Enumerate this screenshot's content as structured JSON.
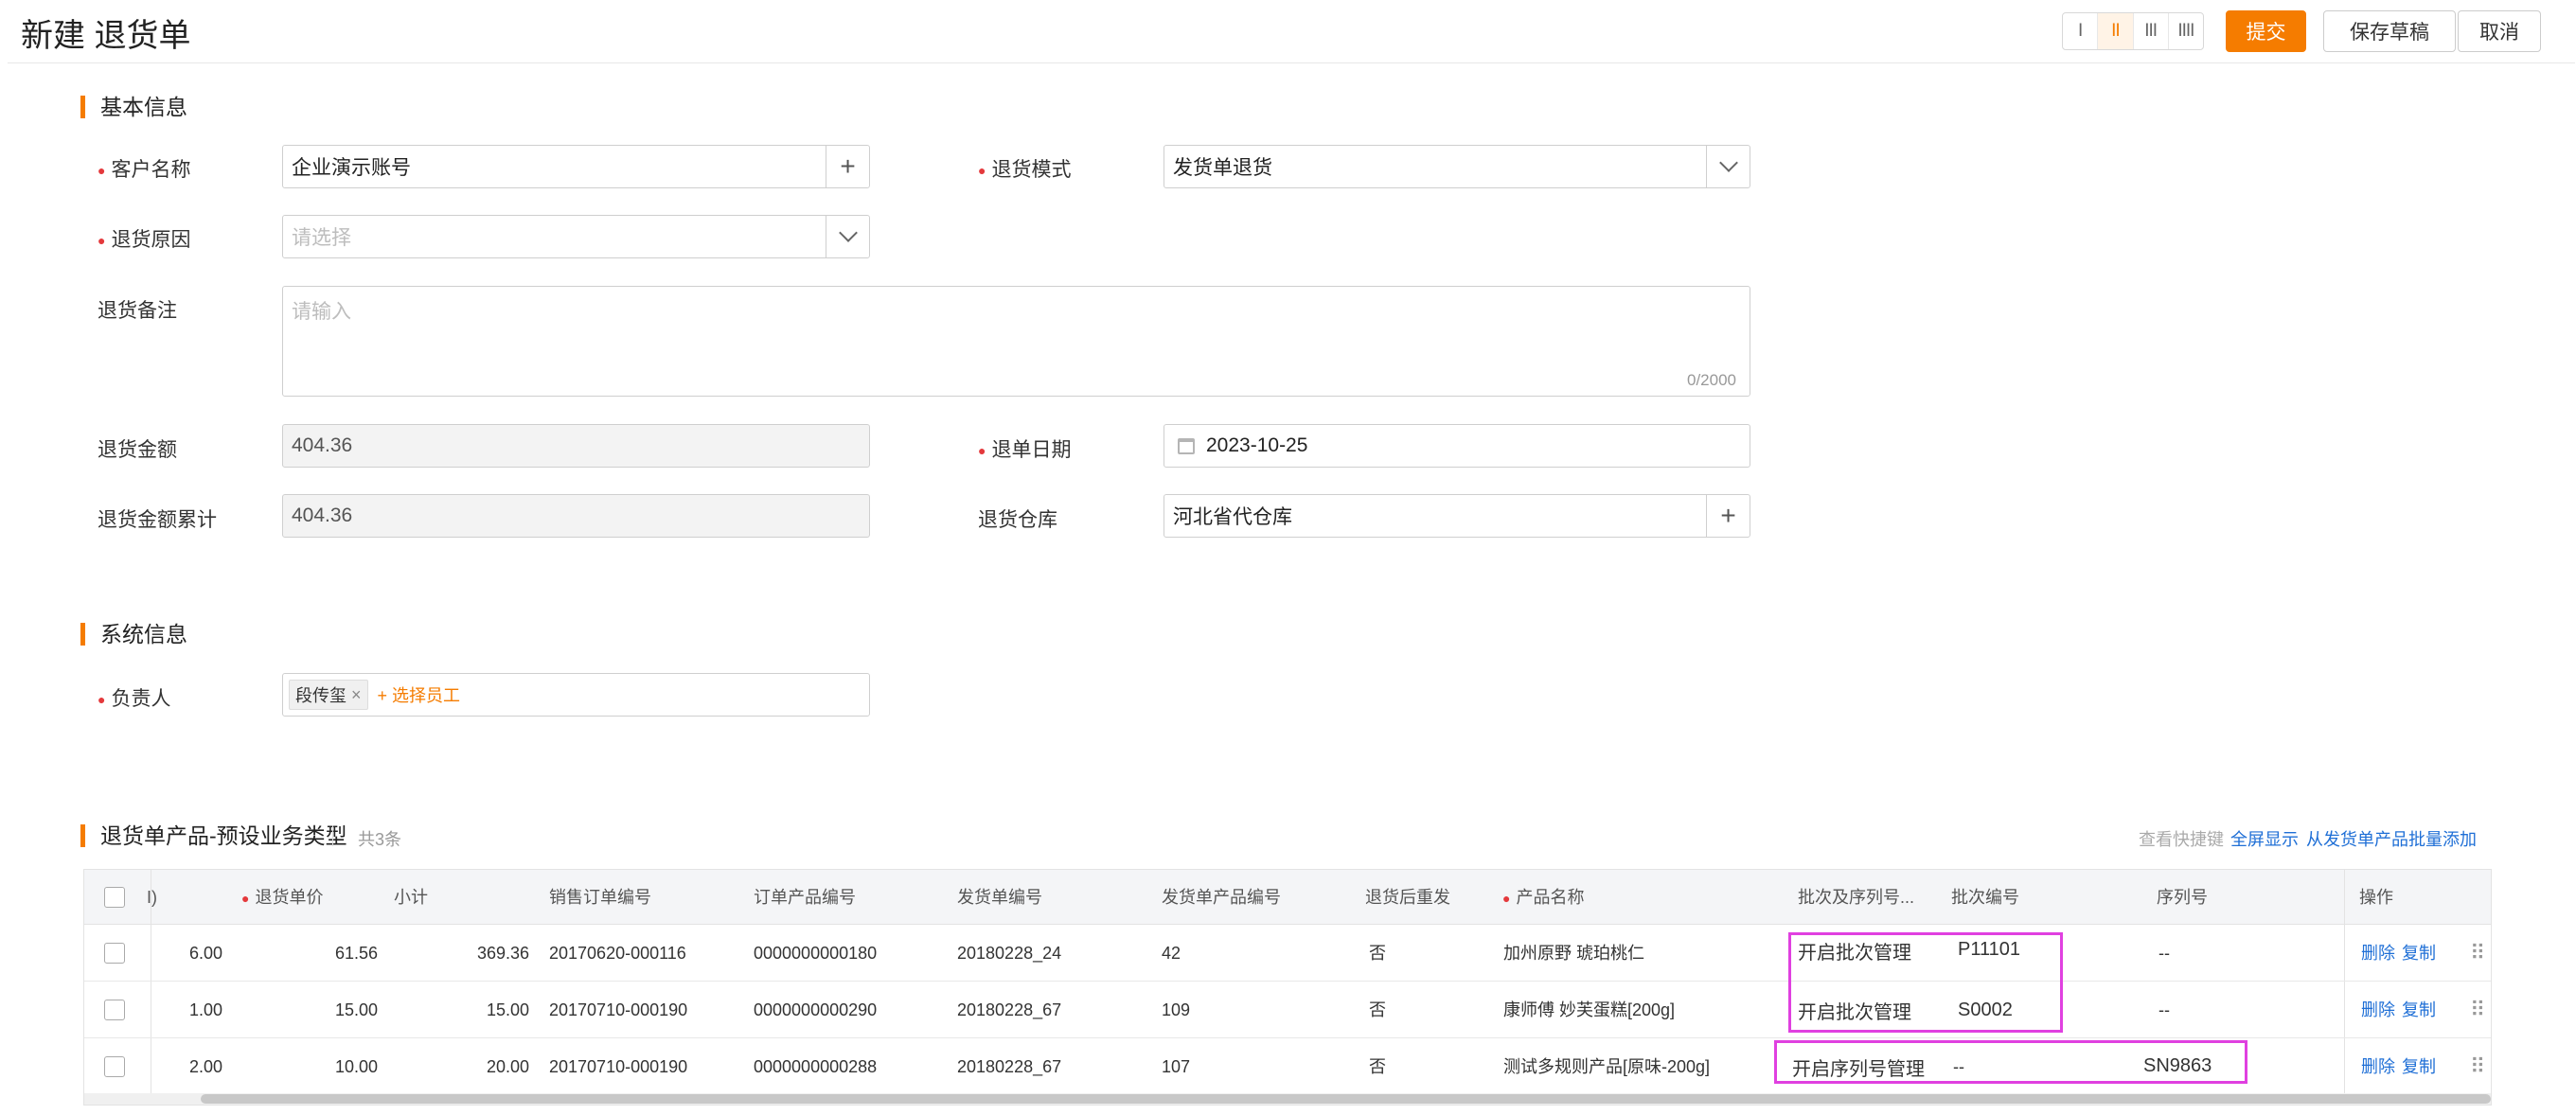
{
  "header": {
    "title": "新建 退货单",
    "layout_options": [
      "I",
      "II",
      "III",
      "IIII"
    ],
    "submit_label": "提交",
    "save_draft_label": "保存草稿",
    "cancel_label": "取消"
  },
  "basic_info": {
    "title": "基本信息",
    "customer": {
      "label": "客户名称",
      "value": "企业演示账号"
    },
    "return_mode": {
      "label": "退货模式",
      "value": "发货单退货"
    },
    "return_reason": {
      "label": "退货原因",
      "placeholder": "请选择"
    },
    "remark": {
      "label": "退货备注",
      "placeholder": "请输入",
      "counter": "0/2000"
    },
    "amount": {
      "label": "退货金额",
      "value": "404.36"
    },
    "return_date": {
      "label": "退单日期",
      "value": "2023-10-25"
    },
    "amount_total": {
      "label": "退货金额累计",
      "value": "404.36"
    },
    "warehouse": {
      "label": "退货仓库",
      "value": "河北省代仓库"
    }
  },
  "system_info": {
    "title": "系统信息",
    "owner": {
      "label": "负责人",
      "tag": "段传玺",
      "tag_close": "×",
      "add_label": "+ 选择员工"
    }
  },
  "products": {
    "title": "退货单产品-预设业务类型",
    "count": "共3条",
    "actions": {
      "shortcuts": "查看快捷键",
      "fullscreen": "全屏显示",
      "batch_add": "从发货单产品批量添加"
    },
    "columns": {
      "qty": "I)",
      "unit_price": "退货单价",
      "subtotal": "小计",
      "sales_order_no": "销售订单编号",
      "order_product_no": "订单产品编号",
      "delivery_no": "发货单编号",
      "delivery_product_no": "发货单产品编号",
      "resend": "退货后重发",
      "product_name": "产品名称",
      "batch_serial": "批次及序列号...",
      "batch_no": "批次编号",
      "serial_no": "序列号",
      "operation": "操作"
    },
    "rows": [
      {
        "qty": "6.00",
        "unit_price": "61.56",
        "subtotal": "369.36",
        "sales_order_no": "20170620-000116",
        "order_product_no": "0000000000180",
        "delivery_no": "20180228_24",
        "delivery_product_no": "42",
        "resend": "否",
        "product_name": "加州原野 琥珀桃仁",
        "batch_serial": "开启批次管理",
        "batch_no": "P11101",
        "serial_no": "--",
        "delete": "删除",
        "copy": "复制"
      },
      {
        "qty": "1.00",
        "unit_price": "15.00",
        "subtotal": "15.00",
        "sales_order_no": "20170710-000190",
        "order_product_no": "0000000000290",
        "delivery_no": "20180228_67",
        "delivery_product_no": "109",
        "resend": "否",
        "product_name": "康师傅 妙芙蛋糕[200g]",
        "batch_serial": "开启批次管理",
        "batch_no": "S0002",
        "serial_no": "--",
        "delete": "删除",
        "copy": "复制"
      },
      {
        "qty": "2.00",
        "unit_price": "10.00",
        "subtotal": "20.00",
        "sales_order_no": "20170710-000190",
        "order_product_no": "0000000000288",
        "delivery_no": "20180228_67",
        "delivery_product_no": "107",
        "resend": "否",
        "product_name": "测试多规则产品[原味-200g]",
        "batch_serial": "开启序列号管理",
        "batch_no": "--",
        "serial_no": "SN9863",
        "delete": "删除",
        "copy": "复制"
      }
    ]
  },
  "colors": {
    "accent": "#f57c00",
    "link": "#1f6fd6",
    "required": "#e4393c",
    "highlight": "#e040e0"
  }
}
